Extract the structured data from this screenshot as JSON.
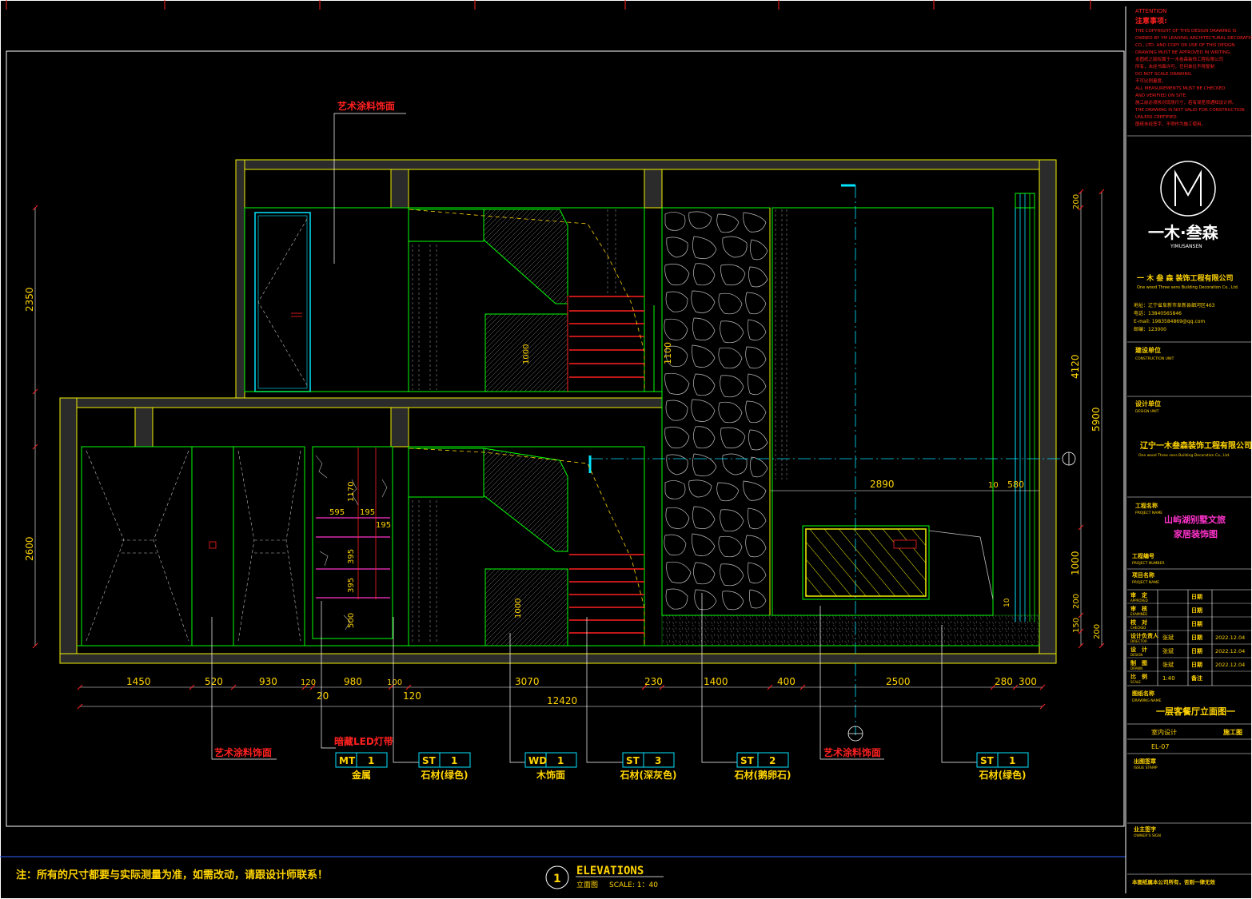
{
  "colors": {
    "background": "#000000",
    "frame": "#ffffff",
    "wall": "#f0f000",
    "wall_fill": "#2b2b2b",
    "panel": "#00ff00",
    "cyan": "#00e5ff",
    "red": "#ff2020",
    "yellow": "#ffd400",
    "magenta": "#ff33cc",
    "gray": "#9a9a9a"
  },
  "annotations": {
    "top_paint": "艺术涂料饰面",
    "bottom_paint_left": "艺术涂料饰面",
    "hidden_led": "暗藏LED灯带",
    "bottom_paint_right": "艺术涂料饰面"
  },
  "material_tags": [
    {
      "code": "MT",
      "num": "1",
      "label": "金属"
    },
    {
      "code": "ST",
      "num": "1",
      "label": "石材(绿色)"
    },
    {
      "code": "WD",
      "num": "1",
      "label": "木饰面"
    },
    {
      "code": "ST",
      "num": "3",
      "label": "石材(深灰色)"
    },
    {
      "code": "ST",
      "num": "2",
      "label": "石材(鹅卵石)"
    },
    {
      "code": "ST",
      "num": "1",
      "label": "石材(绿色)"
    }
  ],
  "dimensions": {
    "bottom_row": [
      "1450",
      "520",
      "930",
      "120",
      "980",
      "100",
      "3070",
      "230",
      "1400",
      "400",
      "2500",
      "280",
      "300"
    ],
    "bottom_sub": [
      "20",
      "120"
    ],
    "total": "12420",
    "left_vertical": [
      "2350",
      "2600"
    ],
    "right_vertical": [
      "200",
      "4120",
      "1000",
      "200",
      "150",
      "200",
      "5900"
    ],
    "interior": [
      "1000",
      "1100",
      "1000",
      "2890",
      "10",
      "580",
      "595",
      "195",
      "195",
      "1170",
      "395",
      "395",
      "500",
      "10"
    ]
  },
  "footer": {
    "note": "注：所有的尺寸都要与实际测量为准，如需改动，请跟设计师联系！",
    "drawing_number": "1",
    "drawing_title": "ELEVATIONS",
    "drawing_subtitle": "立面图",
    "scale": "SCALE: 1：40"
  },
  "title_block": {
    "attention_en": "ATTENTION",
    "attention_cn": "注意事项:",
    "notes": [
      "THE COPYRIGHT OF THIS DESIGN DRAWING IS",
      "OWNED BY YM LEADING ARCHITECTURAL DECORATION",
      "CO., LTD. AND COPY OR USE OF THIS DESIGN",
      "DRAWING MUST BE APPROVED IN WRITING.",
      "本图纸之版权属于一木叁森装饰工程有限公司",
      "所有，未经书面许可，任何单位不得复制",
      "DO NOT SCALE DRAWING.",
      "不可比例量度。",
      "ALL MEASUREMENTS MUST BE CHECKED",
      "AND VERIFIED ON SITE.",
      "施工前必须核对现场尺寸，若有误差须通知设计师。",
      "THE DRAWING IS NOT VALID FOR CONSTRUCTION",
      "UNLESS CERTIFIED.",
      "图纸未经签字，不得作为施工使用。"
    ],
    "logo_cn": "一木·叁森",
    "logo_en": "YIMUSANSEN",
    "company_cn": "一 木 叁 森  装饰工程有限公司",
    "company_en": "One wood Three sens Building Decoration Co., Ltd.",
    "contacts": [
      "地址：辽宁省阜新市阜新县细河区463",
      "电话：13840565846",
      "E-mail: 1983584869@qq.com",
      "邮编：123000"
    ],
    "construction_unit": "建设单位",
    "construction_unit_en": "CONSTRUCTION UNIT",
    "design_unit": "设计单位",
    "design_unit_en": "DESIGN UNIT",
    "design_company": "辽宁一木叁森装饰工程有限公司",
    "design_company_en": "One wood Three sens Building Decoration Co., Ltd.",
    "project_name_label": "工程名称",
    "project_name_en": "PROJECT NAME",
    "project_name_1": "山屿湖别墅文旅",
    "project_name_2": "家居装饰图",
    "rows": [
      {
        "label": "工程编号",
        "en": "PROJECT NUMBER"
      },
      {
        "label": "项目名称",
        "en": "PROJECT NAME"
      }
    ],
    "approval_rows": [
      {
        "label": "审　定",
        "en": "APPROVED",
        "date": "日期"
      },
      {
        "label": "审　核",
        "en": "EXAMINED",
        "date": "日期"
      },
      {
        "label": "校　对",
        "en": "CHECKED",
        "date": "日期"
      },
      {
        "label": "设计负责人",
        "en": "DIRECTOR",
        "name": "张斌",
        "date": "日期",
        "value": "2022.12.04"
      },
      {
        "label": "设　计",
        "en": "DESIGN",
        "name": "张斌",
        "date": "日期",
        "value": "2022.12.04"
      },
      {
        "label": "制　图",
        "en": "DRAWN",
        "name": "张斌",
        "date": "日期",
        "value": "2022.12.04"
      },
      {
        "label": "比　例",
        "en": "SCALE",
        "name": "1:40",
        "date": "备注"
      }
    ],
    "drawing_name_label": "图纸名称",
    "drawing_name_en": "DRAWING NAME",
    "drawing_name": "一层客餐厅立面图一",
    "discipline_label": "室内设计",
    "phase": "施工图",
    "sheet_no": "EL-07",
    "issue_label": "出图签章",
    "issue_en": "ISSUE STAMP",
    "owner_label": "业主签字",
    "owner_en": "OWNER'S SIGN",
    "copyright": "本图纸属本公司所有，否则一律无效"
  }
}
